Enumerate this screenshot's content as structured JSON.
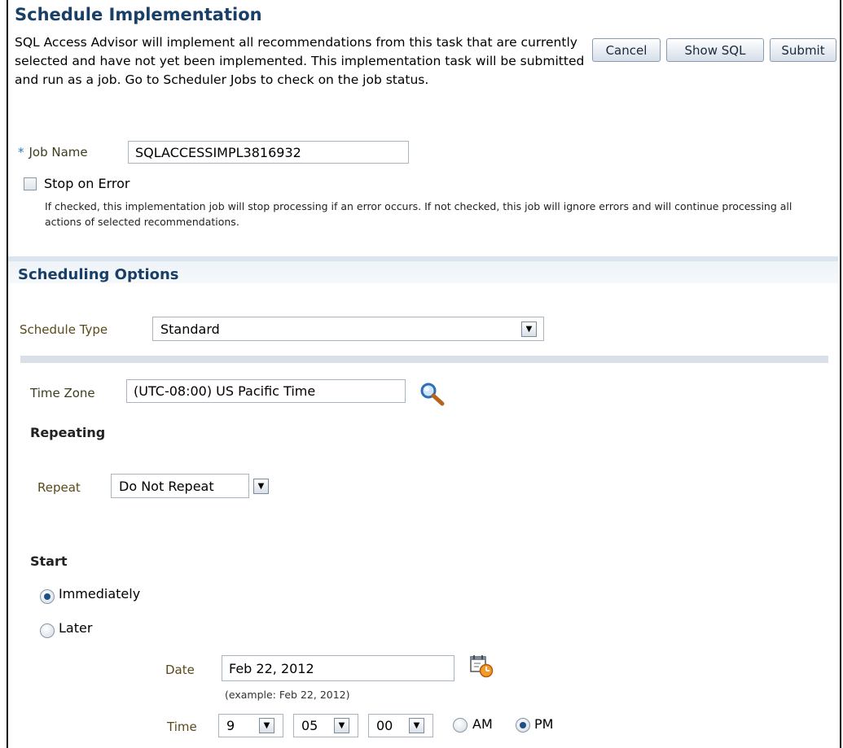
{
  "header": {
    "title": "Schedule Implementation",
    "description": "SQL Access Advisor will implement all recommendations from this task that are currently selected and have not yet been implemented. This implementation task will be submitted and run as a job. Go to Scheduler Jobs to check on the job status."
  },
  "buttons": {
    "cancel": "Cancel",
    "show_sql": "Show SQL",
    "submit": "Submit"
  },
  "job": {
    "required_marker": "*",
    "name_label": "Job Name",
    "name_value": "SQLACCESSIMPL3816932",
    "stop_on_error_label": "Stop on Error",
    "stop_on_error_checked": false,
    "stop_on_error_hint": "If checked, this implementation job will stop processing if an error occurs. If not checked, this job will ignore errors and will continue processing all actions of selected recommendations."
  },
  "scheduling": {
    "section_title": "Scheduling Options",
    "schedule_type_label": "Schedule Type",
    "schedule_type_value": "Standard",
    "time_zone_label": "Time Zone",
    "time_zone_value": "(UTC-08:00) US Pacific Time",
    "repeating_heading": "Repeating",
    "repeat_label": "Repeat",
    "repeat_value": "Do Not Repeat",
    "start_heading": "Start",
    "start_immediately_label": "Immediately",
    "start_later_label": "Later",
    "start_selected": "Immediately",
    "date_label": "Date",
    "date_value": "Feb 22, 2012",
    "date_example": "(example: Feb 22, 2012)",
    "time_label": "Time",
    "hour_value": "9",
    "minute_value": "05",
    "second_value": "00",
    "am_label": "AM",
    "pm_label": "PM",
    "ampm_selected": "PM"
  },
  "icons": {
    "search": "search-icon",
    "calendar": "calendar-clock-icon"
  },
  "colors": {
    "heading_blue": "#1a3f66",
    "section_bar": "#dbe5ef",
    "label_brown": "#5a4a1a"
  }
}
